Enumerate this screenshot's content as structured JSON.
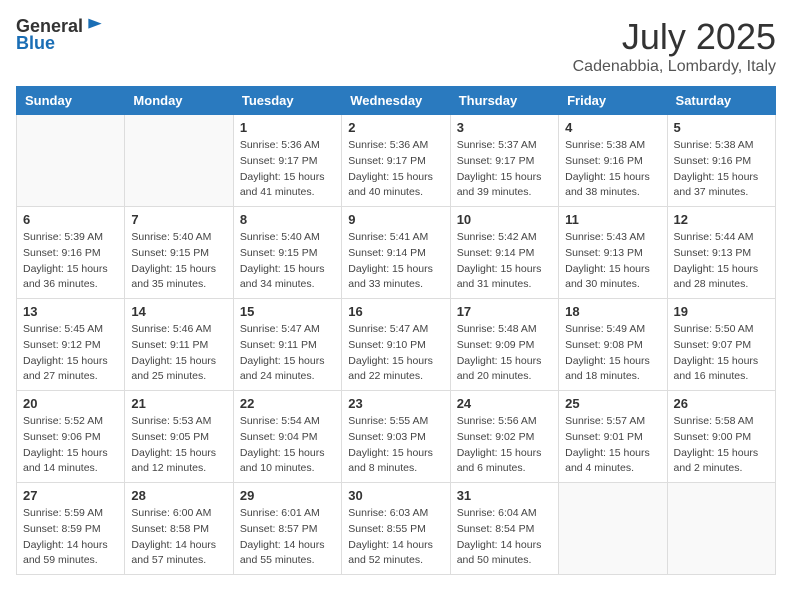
{
  "logo": {
    "general": "General",
    "blue": "Blue"
  },
  "title": {
    "month": "July 2025",
    "location": "Cadenabbia, Lombardy, Italy"
  },
  "weekdays": [
    "Sunday",
    "Monday",
    "Tuesday",
    "Wednesday",
    "Thursday",
    "Friday",
    "Saturday"
  ],
  "weeks": [
    [
      {
        "day": "",
        "info": ""
      },
      {
        "day": "",
        "info": ""
      },
      {
        "day": "1",
        "info": "Sunrise: 5:36 AM\nSunset: 9:17 PM\nDaylight: 15 hours\nand 41 minutes."
      },
      {
        "day": "2",
        "info": "Sunrise: 5:36 AM\nSunset: 9:17 PM\nDaylight: 15 hours\nand 40 minutes."
      },
      {
        "day": "3",
        "info": "Sunrise: 5:37 AM\nSunset: 9:17 PM\nDaylight: 15 hours\nand 39 minutes."
      },
      {
        "day": "4",
        "info": "Sunrise: 5:38 AM\nSunset: 9:16 PM\nDaylight: 15 hours\nand 38 minutes."
      },
      {
        "day": "5",
        "info": "Sunrise: 5:38 AM\nSunset: 9:16 PM\nDaylight: 15 hours\nand 37 minutes."
      }
    ],
    [
      {
        "day": "6",
        "info": "Sunrise: 5:39 AM\nSunset: 9:16 PM\nDaylight: 15 hours\nand 36 minutes."
      },
      {
        "day": "7",
        "info": "Sunrise: 5:40 AM\nSunset: 9:15 PM\nDaylight: 15 hours\nand 35 minutes."
      },
      {
        "day": "8",
        "info": "Sunrise: 5:40 AM\nSunset: 9:15 PM\nDaylight: 15 hours\nand 34 minutes."
      },
      {
        "day": "9",
        "info": "Sunrise: 5:41 AM\nSunset: 9:14 PM\nDaylight: 15 hours\nand 33 minutes."
      },
      {
        "day": "10",
        "info": "Sunrise: 5:42 AM\nSunset: 9:14 PM\nDaylight: 15 hours\nand 31 minutes."
      },
      {
        "day": "11",
        "info": "Sunrise: 5:43 AM\nSunset: 9:13 PM\nDaylight: 15 hours\nand 30 minutes."
      },
      {
        "day": "12",
        "info": "Sunrise: 5:44 AM\nSunset: 9:13 PM\nDaylight: 15 hours\nand 28 minutes."
      }
    ],
    [
      {
        "day": "13",
        "info": "Sunrise: 5:45 AM\nSunset: 9:12 PM\nDaylight: 15 hours\nand 27 minutes."
      },
      {
        "day": "14",
        "info": "Sunrise: 5:46 AM\nSunset: 9:11 PM\nDaylight: 15 hours\nand 25 minutes."
      },
      {
        "day": "15",
        "info": "Sunrise: 5:47 AM\nSunset: 9:11 PM\nDaylight: 15 hours\nand 24 minutes."
      },
      {
        "day": "16",
        "info": "Sunrise: 5:47 AM\nSunset: 9:10 PM\nDaylight: 15 hours\nand 22 minutes."
      },
      {
        "day": "17",
        "info": "Sunrise: 5:48 AM\nSunset: 9:09 PM\nDaylight: 15 hours\nand 20 minutes."
      },
      {
        "day": "18",
        "info": "Sunrise: 5:49 AM\nSunset: 9:08 PM\nDaylight: 15 hours\nand 18 minutes."
      },
      {
        "day": "19",
        "info": "Sunrise: 5:50 AM\nSunset: 9:07 PM\nDaylight: 15 hours\nand 16 minutes."
      }
    ],
    [
      {
        "day": "20",
        "info": "Sunrise: 5:52 AM\nSunset: 9:06 PM\nDaylight: 15 hours\nand 14 minutes."
      },
      {
        "day": "21",
        "info": "Sunrise: 5:53 AM\nSunset: 9:05 PM\nDaylight: 15 hours\nand 12 minutes."
      },
      {
        "day": "22",
        "info": "Sunrise: 5:54 AM\nSunset: 9:04 PM\nDaylight: 15 hours\nand 10 minutes."
      },
      {
        "day": "23",
        "info": "Sunrise: 5:55 AM\nSunset: 9:03 PM\nDaylight: 15 hours\nand 8 minutes."
      },
      {
        "day": "24",
        "info": "Sunrise: 5:56 AM\nSunset: 9:02 PM\nDaylight: 15 hours\nand 6 minutes."
      },
      {
        "day": "25",
        "info": "Sunrise: 5:57 AM\nSunset: 9:01 PM\nDaylight: 15 hours\nand 4 minutes."
      },
      {
        "day": "26",
        "info": "Sunrise: 5:58 AM\nSunset: 9:00 PM\nDaylight: 15 hours\nand 2 minutes."
      }
    ],
    [
      {
        "day": "27",
        "info": "Sunrise: 5:59 AM\nSunset: 8:59 PM\nDaylight: 14 hours\nand 59 minutes."
      },
      {
        "day": "28",
        "info": "Sunrise: 6:00 AM\nSunset: 8:58 PM\nDaylight: 14 hours\nand 57 minutes."
      },
      {
        "day": "29",
        "info": "Sunrise: 6:01 AM\nSunset: 8:57 PM\nDaylight: 14 hours\nand 55 minutes."
      },
      {
        "day": "30",
        "info": "Sunrise: 6:03 AM\nSunset: 8:55 PM\nDaylight: 14 hours\nand 52 minutes."
      },
      {
        "day": "31",
        "info": "Sunrise: 6:04 AM\nSunset: 8:54 PM\nDaylight: 14 hours\nand 50 minutes."
      },
      {
        "day": "",
        "info": ""
      },
      {
        "day": "",
        "info": ""
      }
    ]
  ]
}
